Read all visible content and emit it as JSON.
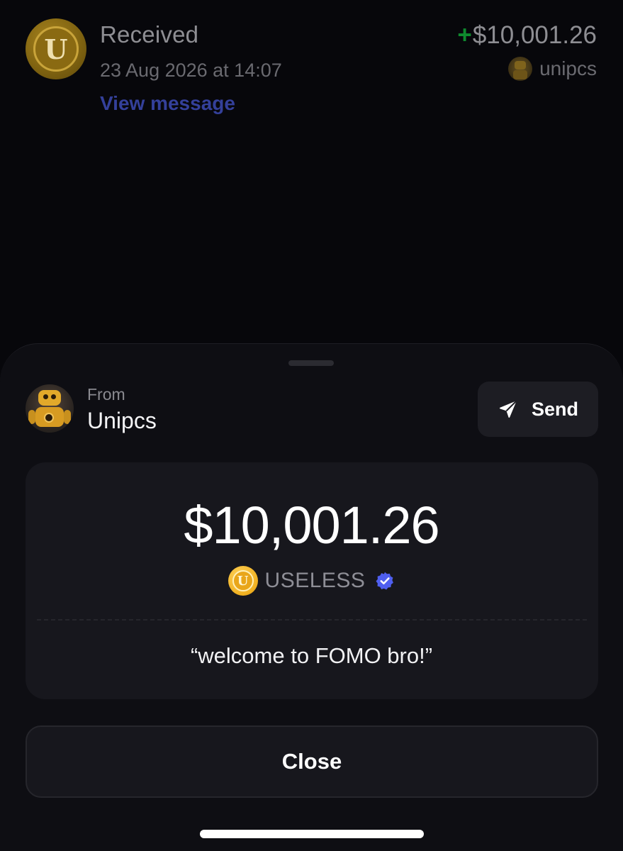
{
  "transaction": {
    "title": "Received",
    "date": "23 Aug 2026 at 14:07",
    "view_message_label": "View message",
    "amount_sign": "+",
    "amount": "$10,001.26",
    "counterparty": "unipcs",
    "token_avatar_letter": "U"
  },
  "sheet": {
    "from_label": "From",
    "from_name": "Unipcs",
    "send_label": "Send",
    "amount": "$10,001.26",
    "token_name": "USELESS",
    "token_letter": "U",
    "memo": "“welcome to FOMO bro!”",
    "close_label": "Close"
  },
  "colors": {
    "background": "#07070b",
    "sheet": "#0e0e13",
    "card": "#17171d",
    "positive": "#0f8a2e",
    "link": "#34409a",
    "verified": "#4f5ff0",
    "coin": "#f0b020"
  },
  "icons": {
    "send": "paper-plane-icon",
    "verified": "verified-badge-icon",
    "token": "useless-coin-icon"
  }
}
